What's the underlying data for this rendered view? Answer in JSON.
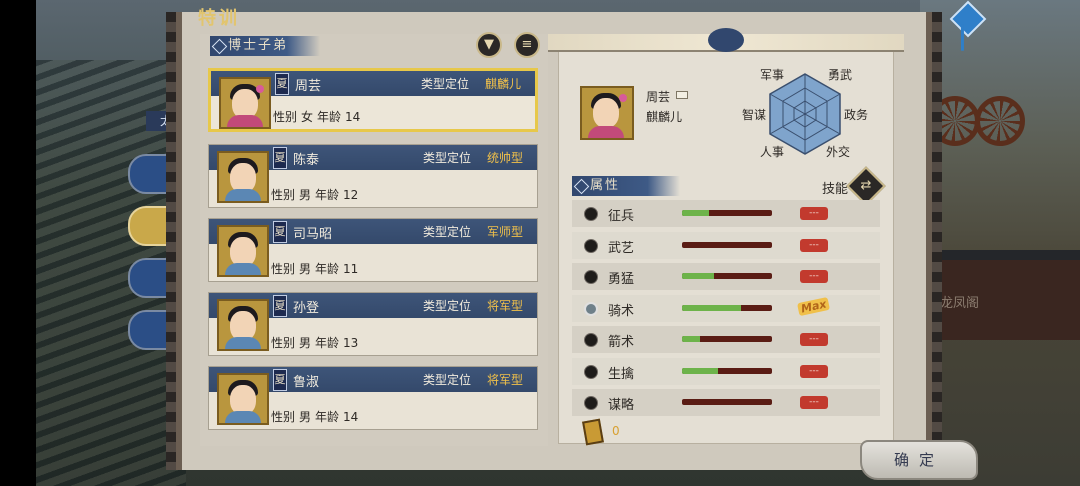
{
  "window": {
    "title": "特训"
  },
  "background": {
    "gate_label": "龙凤阁",
    "side_label": "太"
  },
  "list": {
    "section_title": "博士子弟",
    "filter_icon": "filter-icon",
    "menu_icon": "list-menu-icon",
    "role_label": "类型定位",
    "gender_label": "性别",
    "age_label": "年龄",
    "cards": [
      {
        "faction": "夏",
        "name": "周芸",
        "role": "麒麟儿",
        "gender": "女",
        "age": "14",
        "selected": true,
        "portrait": "girl"
      },
      {
        "faction": "夏",
        "name": "陈泰",
        "role": "统帅型",
        "gender": "男",
        "age": "12",
        "selected": false,
        "portrait": "boy"
      },
      {
        "faction": "夏",
        "name": "司马昭",
        "role": "军师型",
        "gender": "男",
        "age": "11",
        "selected": false,
        "portrait": "boy"
      },
      {
        "faction": "夏",
        "name": "孙登",
        "role": "将军型",
        "gender": "男",
        "age": "13",
        "selected": false,
        "portrait": "boy"
      },
      {
        "faction": "夏",
        "name": "鲁淑",
        "role": "将军型",
        "gender": "男",
        "age": "14",
        "selected": false,
        "portrait": "boy"
      }
    ]
  },
  "detail": {
    "name": "周芸",
    "role": "麒麟儿",
    "radar": {
      "labels": {
        "military": "军事",
        "valor": "勇武",
        "politics": "政务",
        "diplomacy": "外交",
        "personnel": "人事",
        "strategy": "智谋"
      }
    },
    "attributes_title": "属性",
    "skills_label": "技能",
    "attributes": [
      {
        "name": "征兵",
        "level": 0.3,
        "badge": "---",
        "max": false
      },
      {
        "name": "武艺",
        "level": 0.0,
        "badge": "---",
        "max": false
      },
      {
        "name": "勇猛",
        "level": 0.35,
        "badge": "---",
        "max": false
      },
      {
        "name": "骑术",
        "level": 0.65,
        "badge": "Max",
        "max": true
      },
      {
        "name": "箭术",
        "level": 0.2,
        "badge": "---",
        "max": false
      },
      {
        "name": "生擒",
        "level": 0.4,
        "badge": "---",
        "max": false
      },
      {
        "name": "谋略",
        "level": 0.0,
        "badge": "---",
        "max": false
      }
    ],
    "token_count": "0"
  },
  "confirm_label": "确定",
  "colors": {
    "accent_gold": "#e7c84a",
    "header_blue": "#34496b",
    "bar_green": "#6db34a",
    "bar_red": "#5a1c14"
  }
}
